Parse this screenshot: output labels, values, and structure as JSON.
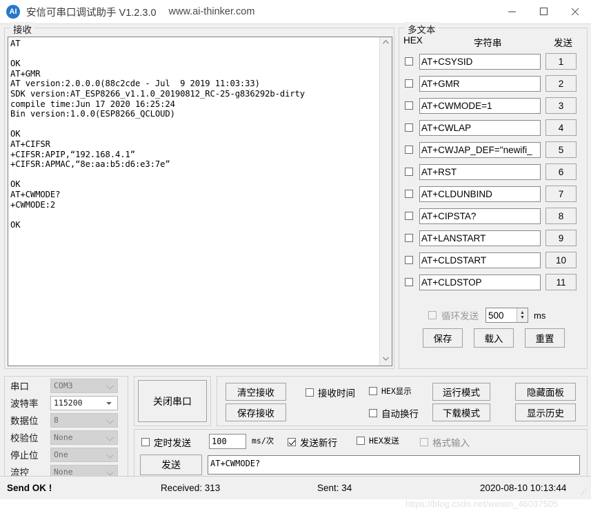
{
  "window": {
    "icon": "app-logo-icon",
    "title": "安信可串口调试助手 V1.2.3.0",
    "url": "www.ai-thinker.com",
    "minimize": "—",
    "maximize": "▢",
    "close": "✕"
  },
  "receive": {
    "legend": "接收",
    "console_text": "AT\n\nOK\nAT+GMR\nAT version:2.0.0.0(88c2cde - Jul  9 2019 11:03:33)\nSDK version:AT_ESP8266_v1.1.0_20190812_RC-25-g836292b-dirty\ncompile time:Jun 17 2020 16:25:24\nBin version:1.0.0(ESP8266_QCLOUD)\n\nOK\nAT+CIFSR\n+CIFSR:APIP,“192.168.4.1”\n+CIFSR:APMAC,“8e:aa:b5:d6:e3:7e”\n\nOK\nAT+CWMODE?\n+CWMODE:2\n\nOK\n",
    "scroll_up": "⌃",
    "scroll_down": "⌄"
  },
  "multitext": {
    "legend": "多文本",
    "header_hex": "HEX",
    "header_string": "字符串",
    "header_send": "发送",
    "rows": [
      {
        "hex_checked": false,
        "command": "AT+CSYSID",
        "send_label": "1"
      },
      {
        "hex_checked": false,
        "command": "AT+GMR",
        "send_label": "2"
      },
      {
        "hex_checked": false,
        "command": "AT+CWMODE=1",
        "send_label": "3"
      },
      {
        "hex_checked": false,
        "command": "AT+CWLAP",
        "send_label": "4"
      },
      {
        "hex_checked": false,
        "command": "AT+CWJAP_DEF=\"newifi_",
        "send_label": "5"
      },
      {
        "hex_checked": false,
        "command": "AT+RST",
        "send_label": "6"
      },
      {
        "hex_checked": false,
        "command": "AT+CLDUNBIND",
        "send_label": "7"
      },
      {
        "hex_checked": false,
        "command": "AT+CIPSTA?",
        "send_label": "8"
      },
      {
        "hex_checked": false,
        "command": "AT+LANSTART",
        "send_label": "9"
      },
      {
        "hex_checked": false,
        "command": "AT+CLDSTART",
        "send_label": "10"
      },
      {
        "hex_checked": false,
        "command": "AT+CLDSTOP",
        "send_label": "11"
      }
    ],
    "loop_send_label": "循环发送",
    "loop_send_checked": false,
    "loop_interval": "500",
    "loop_unit": "ms",
    "save_label": "保存",
    "load_label": "载入",
    "reset_label": "重置"
  },
  "port": {
    "rows": [
      {
        "label": "串口",
        "value": "COM3",
        "editable": false
      },
      {
        "label": "波特率",
        "value": "115200",
        "editable": true
      },
      {
        "label": "数据位",
        "value": "8",
        "editable": false
      },
      {
        "label": "校验位",
        "value": "None",
        "editable": false
      },
      {
        "label": "停止位",
        "value": "One",
        "editable": false
      },
      {
        "label": "流控",
        "value": "None",
        "editable": false
      }
    ],
    "close_port_label": "关闭串口"
  },
  "recv_controls": {
    "clear_recv": "清空接收",
    "save_recv": "保存接收",
    "recv_time_label": "接收时间",
    "recv_time_checked": false,
    "hex_display_label": "HEX显示",
    "hex_display_checked": false,
    "auto_wrap_label": "自动换行",
    "auto_wrap_checked": false,
    "run_mode": "运行模式",
    "download_mode": "下载模式",
    "hide_panel": "隐藏面板",
    "show_history": "显示历史"
  },
  "send_panel": {
    "timed_send_label": "定时发送",
    "timed_send_checked": false,
    "interval_value": "100",
    "interval_unit": "ms/次",
    "newline_label": "发送新行",
    "newline_checked": true,
    "hex_send_label": "HEX发送",
    "hex_send_checked": false,
    "format_input_label": "格式输入",
    "format_input_checked": false,
    "send_button": "发送",
    "send_text": "AT+CWMODE?"
  },
  "statusbar": {
    "status": "Send OK !",
    "received": "Received: 313",
    "sent": "Sent: 34",
    "datetime": "2020-08-10 10:13:44",
    "watermark": "https://blog.csdn.net/weixin_46037505"
  }
}
